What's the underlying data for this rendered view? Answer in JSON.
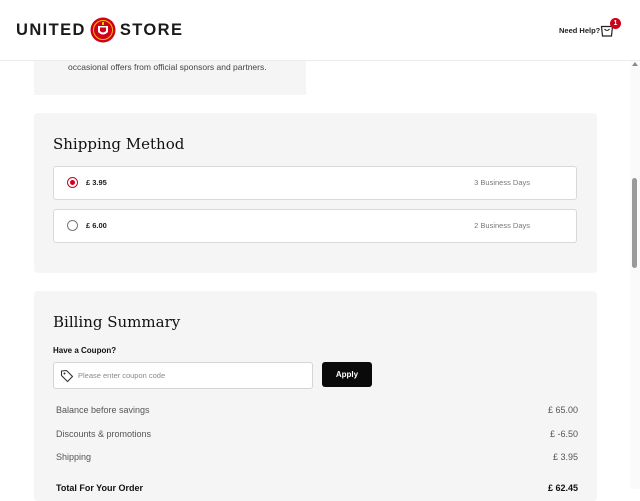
{
  "header": {
    "logo_left": "UNITED",
    "logo_right": "STORE",
    "need_help": "Need Help?",
    "cart_count": "1"
  },
  "promo": {
    "text": "occasional offers from official sponsors and partners."
  },
  "shipping": {
    "title": "Shipping Method",
    "options": [
      {
        "price": "£ 3.95",
        "days": "3 Business Days",
        "selected": true
      },
      {
        "price": "£ 6.00",
        "days": "2 Business Days",
        "selected": false
      }
    ]
  },
  "billing": {
    "title": "Billing Summary",
    "coupon_label": "Have a Coupon?",
    "coupon_placeholder": "Please enter coupon code",
    "apply_label": "Apply",
    "rows": [
      {
        "label": "Balance before savings",
        "value": "£ 65.00"
      },
      {
        "label": "Discounts & promotions",
        "value": "£ -6.50"
      },
      {
        "label": "Shipping",
        "value": "£ 3.95"
      },
      {
        "label": "Total For Your Order",
        "value": "£ 62.45"
      }
    ]
  },
  "colors": {
    "accent_red": "#d0001a",
    "button_black": "#0a0a0a",
    "card_bg": "#f5f5f5"
  }
}
